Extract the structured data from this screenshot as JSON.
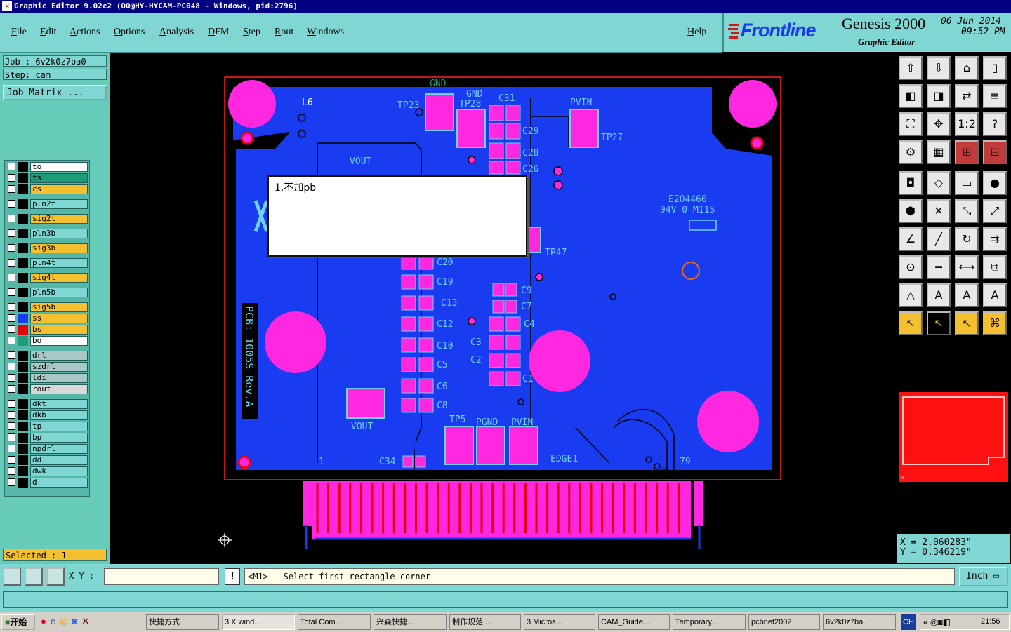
{
  "window": {
    "title": "Graphic Editor 9.02c2 (OO@HY-HYCAM-PC048 - Windows, pid:2796)"
  },
  "menu": [
    "File",
    "Edit",
    "Actions",
    "Options",
    "Analysis",
    "DFM",
    "Step",
    "Rout",
    "Windows"
  ],
  "help": "Help",
  "brand": {
    "logo": "Frontline",
    "product": "Genesis 2000",
    "subtitle": "Graphic Editor",
    "date": "06 Jun 2014",
    "time": "09:52 PM"
  },
  "job": {
    "label": "Job : 6v2k0z7ba0",
    "step": "Step: cam",
    "matrix_button": "Job Matrix ..."
  },
  "layers": [
    {
      "name": "to",
      "color": "#ffffff",
      "sw": "#000000"
    },
    {
      "name": "ts",
      "color": "#1e9b77",
      "sw": "#000000"
    },
    {
      "name": "cs",
      "color": "#f5c030",
      "sw": "#000000"
    },
    {
      "name": "pln2t",
      "color": "#7fd6d2",
      "sw": "#000000"
    },
    {
      "name": "sig2t",
      "color": "#f5c030",
      "sw": "#000000"
    },
    {
      "name": "pln3b",
      "color": "#7fd6d2",
      "sw": "#000000"
    },
    {
      "name": "sig3b",
      "color": "#f5c030",
      "sw": "#000000"
    },
    {
      "name": "pln4t",
      "color": "#7fd6d2",
      "sw": "#000000"
    },
    {
      "name": "sig4t",
      "color": "#f5c030",
      "sw": "#000000"
    },
    {
      "name": "pln5b",
      "color": "#7fd6d2",
      "sw": "#000000"
    },
    {
      "name": "sig5b",
      "color": "#f5c030",
      "sw": "#000000"
    },
    {
      "name": "ss",
      "color": "#f5c030",
      "sw": "#1a3cf0"
    },
    {
      "name": "bs",
      "color": "#f5c030",
      "sw": "#e8000a"
    },
    {
      "name": "bo",
      "color": "#ffffff",
      "sw": "#1e9b77"
    },
    {
      "name": "drl",
      "color": "#a9c7c5",
      "sw": "#000000"
    },
    {
      "name": "szdrl",
      "color": "#a9c7c5",
      "sw": "#000000"
    },
    {
      "name": "ldi",
      "color": "#a9c7c5",
      "sw": "#000000"
    },
    {
      "name": "rout",
      "color": "#d8d8d8",
      "sw": "#000000"
    },
    {
      "name": "dkt",
      "color": "#7fd6d2",
      "sw": "#000000"
    },
    {
      "name": "dkb",
      "color": "#7fd6d2",
      "sw": "#000000"
    },
    {
      "name": "tp",
      "color": "#7fd6d2",
      "sw": "#000000"
    },
    {
      "name": "bp",
      "color": "#7fd6d2",
      "sw": "#000000"
    },
    {
      "name": "npdrl",
      "color": "#7fd6d2",
      "sw": "#000000"
    },
    {
      "name": "dd",
      "color": "#7fd6d2",
      "sw": "#000000"
    },
    {
      "name": "dwk",
      "color": "#7fd6d2",
      "sw": "#000000"
    },
    {
      "name": "d",
      "color": "#7fd6d2",
      "sw": "#000000"
    }
  ],
  "selected": "Selected : 1",
  "note": "1.不加pb",
  "pcb_labels": {
    "gnd": "GND",
    "tp23": "TP23",
    "tp28": "TP28",
    "gnd2": "GND",
    "c31": "C31",
    "pvin": "PVIN",
    "tp27": "TP27",
    "c29": "C29",
    "c28": "C28",
    "c26": "C26",
    "vout": "VOUT",
    "l6": "L6",
    "tp47": "TP47",
    "c20": "C20",
    "c19": "C19",
    "c13": "C13",
    "c12": "C12",
    "c10": "C10",
    "c5": "C5",
    "c6": "C6",
    "c8": "C8",
    "c9": "C9",
    "c7": "C7",
    "c4": "C4",
    "c3": "C3",
    "c2": "C2",
    "c1": "C1",
    "vout2": "VOUT",
    "tp5": "TP5",
    "pgnd": "PGND",
    "pvin2": "PVIN",
    "c34": "C34",
    "edge1": "EDGE1",
    "pin79": "79",
    "pin1": "1",
    "e": "E204460",
    "ul": "94V-0 M11S",
    "pcb": "PCB: 1005S Rev.A"
  },
  "coords": {
    "x": "X = 2.060283\"",
    "y": "Y = 0.346219\""
  },
  "cmd": {
    "xy_label": "X Y :",
    "message": "<M1> - Select first rectangle corner",
    "units": "Inch"
  },
  "taskbar": {
    "start": "开始",
    "tasks": [
      "快捷方式 ...",
      "3 X wind...",
      "Total Com...",
      "兴森快捷...",
      "制作规范 ...",
      "3 Micros...",
      "CAM_Guide...",
      "Temporary...",
      "pcbnet2002",
      "6v2k0z7ba..."
    ],
    "lang": "CH",
    "clock": "21:56"
  }
}
